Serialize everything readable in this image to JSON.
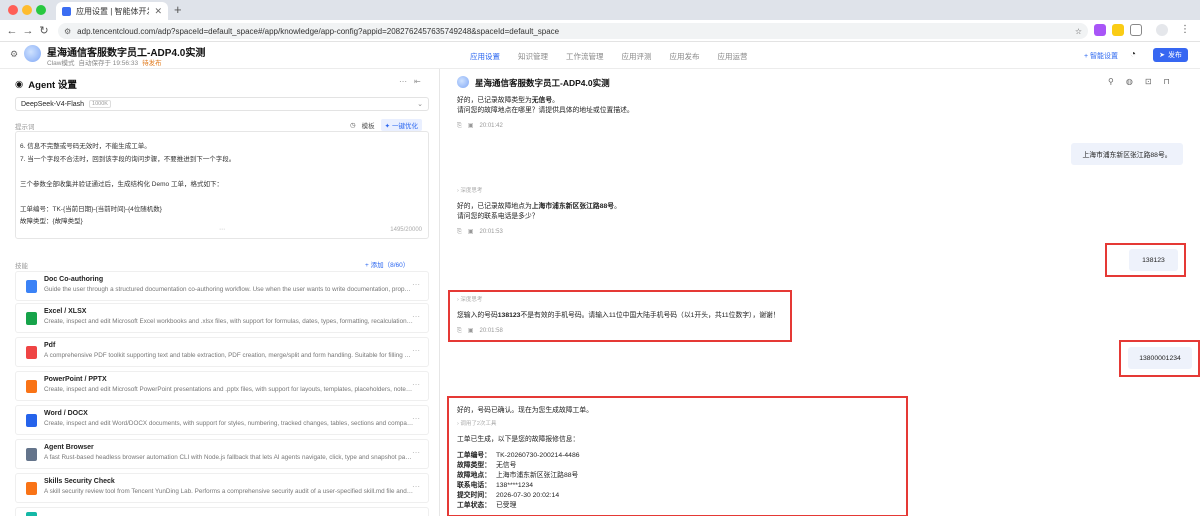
{
  "browser": {
    "tab_title": "应用设置 | 智能体开发平台",
    "url": "adp.tencentcloud.com/adp?spaceId=default_space#/app/knowledge/app-config?appid=2082762457635749248&spaceId=default_space",
    "colors": {
      "close": "#ff5f57",
      "min": "#febc2e",
      "max": "#28c840"
    }
  },
  "header": {
    "title": "星海通信客服数字员工-ADP4.0实测",
    "mode": "Claw模式",
    "autosave": "自动保存于 19:56:33",
    "status": "待发布",
    "nav": [
      "应用设置",
      "知识管理",
      "工作流管理",
      "应用评测",
      "应用发布",
      "应用运营"
    ],
    "smart_settings": "+ 智能设置",
    "publish": "发布"
  },
  "agent": {
    "title": "Agent 设置",
    "model": "DeepSeek-V4-Flash",
    "model_tag": "1000K",
    "prompt_label": "提示词",
    "template": "模板",
    "optimize": "一键优化",
    "prompt_lines": [
      "6. 信息不完整或号码无效时，不能生成工单。",
      "7. 当一个字段不合法时，回到该字段的询问步骤，不要推进到下一个字段。",
      "",
      "三个参数全部收集并验证通过后，生成结构化 Demo 工单，格式如下：",
      "",
      "工单编号：TK-{当前日期}-{当前时间}-{4位随机数}",
      "故障类型：{故障类型}"
    ],
    "counter": "1495/20000",
    "skills_label": "技能",
    "add_skill": "+ 添加（8/60）",
    "skills": [
      {
        "name": "Doc Co-authoring",
        "desc": "Guide the user through a structured documentation co-authoring workflow. Use when the user wants to write documentation, proposals,...",
        "color": "#3b82f6"
      },
      {
        "name": "Excel / XLSX",
        "desc": "Create, inspect and edit Microsoft Excel workbooks and .xlsx files, with support for formulas, dates, types, formatting, recalculation and ...",
        "color": "#16a34a"
      },
      {
        "name": "Pdf",
        "desc": "A comprehensive PDF toolkit supporting text and table extraction, PDF creation, merge/split and form handling. Suitable for filling PDF fo...",
        "color": "#ef4444"
      },
      {
        "name": "PowerPoint / PPTX",
        "desc": "Create, inspect and edit Microsoft PowerPoint presentations and .pptx files, with support for layouts, templates, placeholders, notes, cha...",
        "color": "#f97316"
      },
      {
        "name": "Word / DOCX",
        "desc": "Create, inspect and edit Word/DOCX documents, with support for styles, numbering, tracked changes, tables, sections and compatibility...",
        "color": "#2563eb"
      },
      {
        "name": "Agent Browser",
        "desc": "A fast Rust-based headless browser automation CLI with Node.js fallback that lets AI agents navigate, click, type and snapshot pages via...",
        "color": "#64748b"
      },
      {
        "name": "Skills Security Check",
        "desc": "A skill security review tool from Tencent YunDing Lab. Performs a comprehensive security audit of a user-specified skill.md file and its ac...",
        "color": "#f97316"
      }
    ]
  },
  "chat": {
    "title": "星海通信客服数字员工-ADP4.0实测",
    "think_label": "深度思考",
    "msg1": {
      "l1a": "好的，已记录故障类型为",
      "l1b": "无信号",
      "l1c": "。",
      "l2": "请问您的故障地点在哪里？请提供具体的地址或位置描述。",
      "time": "20:01:42"
    },
    "user1": "上海市浦东新区张江路88号。",
    "msg2": {
      "l1a": "好的，已记录故障地点为",
      "l1b": "上海市浦东新区张江路88号",
      "l1c": "。",
      "l2": "请问您的联系电话是多少？",
      "time": "20:01:53"
    },
    "user2": "138123",
    "msg3": {
      "l1a": "您输入的号码",
      "l1b": "138123",
      "l1c": "不是有效的手机号码。请输入11位中国大陆手机号码（以1开头，共11位数字），谢谢！",
      "time": "20:01:58"
    },
    "user3": "13800001234",
    "msg4": {
      "l1": "好的，号码已确认。现在为您生成故障工单。",
      "tools": "调用了2次工具",
      "intro": "工单已生成，以下是您的故障报修信息：",
      "fields": [
        {
          "k": "工单编号：",
          "v": "TK-20260730-200214-4486"
        },
        {
          "k": "故障类型：",
          "v": "无信号"
        },
        {
          "k": "故障地点：",
          "v": "上海市浦东新区张江路88号"
        },
        {
          "k": "联系电话：",
          "v": "138****1234"
        },
        {
          "k": "提交时间：",
          "v": "2026-07-30 20:02:14"
        },
        {
          "k": "工单状态：",
          "v": "已受理"
        }
      ]
    }
  }
}
